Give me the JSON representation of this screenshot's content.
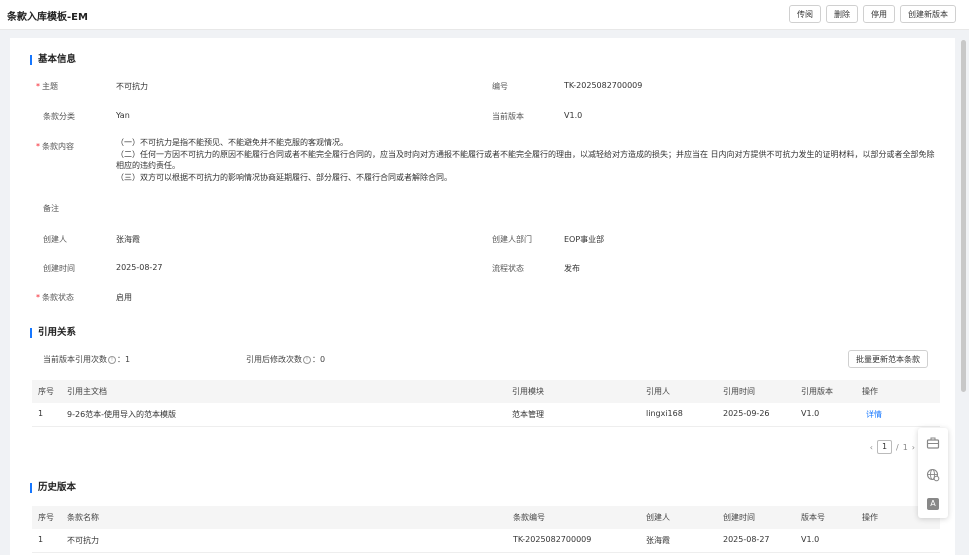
{
  "header": {
    "title": "条款入库模板-EM",
    "actions": [
      "传阅",
      "删除",
      "停用",
      "创建新版本"
    ]
  },
  "basic": {
    "section_title": "基本信息",
    "subject_label": "主题",
    "subject_value": "不可抗力",
    "code_label": "编号",
    "code_value": "TK-2025082700009",
    "category_label": "条款分类",
    "category_value": "Yan",
    "version_label": "当前版本",
    "version_value": "V1.0",
    "content_label": "条款内容",
    "content_lines": [
      "（一）不可抗力是指不能预见、不能避免并不能克服的客观情况。",
      "（二）任何一方因不可抗力的原因不能履行合同或者不能完全履行合同的，应当及时向对方通报不能履行或者不能完全履行的理由，以减轻给对方造成的损失；并应当在 日内向对方提供不可抗力发生的证明材料，以部分或者全部免除相应的违约责任。",
      "（三）双方可以根据不可抗力的影响情况协商延期履行、部分履行、不履行合同或者解除合同。"
    ],
    "remark_label": "备注",
    "creator_label": "创建人",
    "creator_value": "张海霞",
    "dept_label": "创建人部门",
    "dept_value": "EOP事业部",
    "created_label": "创建时间",
    "created_value": "2025-08-27",
    "flow_label": "流程状态",
    "flow_value": "发布",
    "status_label": "条款状态",
    "status_value": "启用"
  },
  "refs": {
    "section_title": "引用关系",
    "count_label": "当前版本引用次数",
    "count_value": "1",
    "modified_label": "引用后修改次数",
    "modified_value": "0",
    "colon": "：",
    "bulk_button": "批量更新范本条款",
    "columns": [
      "序号",
      "引用主文档",
      "引用模块",
      "引用人",
      "引用时间",
      "引用版本",
      "操作"
    ],
    "row": {
      "no": "1",
      "doc": "9-26范本-使用导入的范本模版",
      "module": "范本管理",
      "user": "lingxi168",
      "time": "2025-09-26",
      "version": "V1.0",
      "action": "详情"
    },
    "pager": {
      "prev": "‹",
      "current": "1",
      "sep": "/",
      "total": "1",
      "next": "›"
    }
  },
  "history": {
    "section_title": "历史版本",
    "columns": [
      "序号",
      "条款名称",
      "条款编号",
      "创建人",
      "创建时间",
      "版本号",
      "操作"
    ],
    "row": {
      "no": "1",
      "name": "不可抗力",
      "code": "TK-2025082700009",
      "creator": "张海霞",
      "time": "2025-08-27",
      "version": "V1.0"
    }
  },
  "tools": {
    "icons": [
      "briefcase-icon",
      "globe-settings-icon",
      "translate-icon"
    ],
    "translate_glyph": "A"
  },
  "colors": {
    "accent": "#1677ff",
    "required": "#f5222d"
  }
}
